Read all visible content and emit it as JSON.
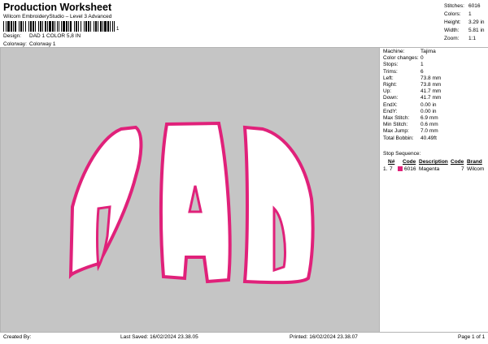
{
  "header": {
    "title": "Production Worksheet",
    "subtitle": "Wilcom EmbroideryStudio – Level 3 Advanced",
    "barcode_tail": "1"
  },
  "meta": {
    "design_label": "Design:",
    "design_value": "DAD 1 COLOR 5,8 IN",
    "colorway_label": "Colorway:",
    "colorway_value": "Colorway 1"
  },
  "top_stats": [
    {
      "label": "Stitches:",
      "value": "6016"
    },
    {
      "label": "Colors:",
      "value": "1"
    },
    {
      "label": "Height:",
      "value": "3.29 in"
    },
    {
      "label": "Width:",
      "value": "5.81 in"
    },
    {
      "label": "Zoom:",
      "value": "1:1"
    }
  ],
  "design": {
    "text": "DAD",
    "thread_color": "#e0217a",
    "fill_color": "#ffffff",
    "background": "#c5c5c5"
  },
  "info": [
    {
      "label": "Machine:",
      "value": "Tajima"
    },
    {
      "label": "Color changes:",
      "value": "0"
    },
    {
      "label": "Stops:",
      "value": "1"
    },
    {
      "label": "Trims:",
      "value": "6"
    },
    {
      "label": "Left:",
      "value": "73.8 mm"
    },
    {
      "label": "Right:",
      "value": "73.8 mm"
    },
    {
      "label": "Up:",
      "value": "41.7 mm"
    },
    {
      "label": "Down:",
      "value": "41.7 mm"
    },
    {
      "label": "EndX:",
      "value": "0.00 in"
    },
    {
      "label": "EndY:",
      "value": "0.00 in"
    },
    {
      "label": "Max Stitch:",
      "value": "6.9 mm"
    },
    {
      "label": "Min Stitch:",
      "value": "0.6 mm"
    },
    {
      "label": "Max Jump:",
      "value": "7.0 mm"
    },
    {
      "label": "Total Bobbin:",
      "value": "40.49ft"
    }
  ],
  "stop_sequence": {
    "title": "Stop Sequence:",
    "headers": {
      "n": "N#",
      "code": "Code",
      "description": "Description",
      "code2": "Code",
      "brand": "Brand"
    },
    "rows": [
      {
        "index": "1.",
        "n": "7",
        "swatch": "#e0217a",
        "code": "6016",
        "description": "Magenta",
        "code2": "7",
        "brand": "Wilcom"
      }
    ]
  },
  "footer": {
    "created_by": "Created By:",
    "last_saved": "Last Saved: 16/02/2024 23.38.05",
    "printed": "Printed: 16/02/2024 23.38.07",
    "page": "Page 1 of 1"
  }
}
